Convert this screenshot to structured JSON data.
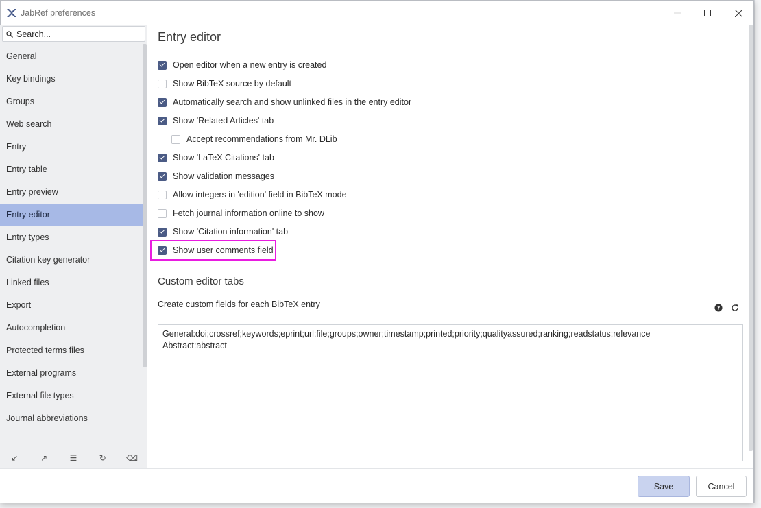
{
  "window": {
    "title": "JabRef preferences",
    "controls": {
      "minimize": "—",
      "maximize": "☐",
      "close": "✕"
    }
  },
  "sidebar": {
    "search_placeholder": "Search...",
    "items": [
      {
        "label": "General"
      },
      {
        "label": "Key bindings"
      },
      {
        "label": "Groups"
      },
      {
        "label": "Web search"
      },
      {
        "label": "Entry"
      },
      {
        "label": "Entry table"
      },
      {
        "label": "Entry preview"
      },
      {
        "label": "Entry editor",
        "selected": true
      },
      {
        "label": "Entry types"
      },
      {
        "label": "Citation key generator"
      },
      {
        "label": "Linked files"
      },
      {
        "label": "Export"
      },
      {
        "label": "Autocompletion"
      },
      {
        "label": "Protected terms files"
      },
      {
        "label": "External programs"
      },
      {
        "label": "External file types"
      },
      {
        "label": "Journal abbreviations"
      }
    ],
    "tools": [
      {
        "icon": "import-arrow-icon",
        "glyph": "↙"
      },
      {
        "icon": "export-arrow-icon",
        "glyph": "↗"
      },
      {
        "icon": "list-icon",
        "glyph": "☰"
      },
      {
        "icon": "refresh-icon",
        "glyph": "↻"
      },
      {
        "icon": "eraser-icon",
        "glyph": "⌫"
      }
    ]
  },
  "main": {
    "title": "Entry editor",
    "options": [
      {
        "label": "Open editor when a new entry is created",
        "checked": true,
        "indent": 0
      },
      {
        "label": "Show BibTeX source by default",
        "checked": false,
        "indent": 0
      },
      {
        "label": "Automatically search and show unlinked files in the entry editor",
        "checked": true,
        "indent": 0
      },
      {
        "label": "Show 'Related Articles' tab",
        "checked": true,
        "indent": 0
      },
      {
        "label": "Accept recommendations from Mr. DLib",
        "checked": false,
        "indent": 1
      },
      {
        "label": "Show 'LaTeX Citations' tab",
        "checked": true,
        "indent": 0
      },
      {
        "label": "Show validation messages",
        "checked": true,
        "indent": 0
      },
      {
        "label": "Allow integers in 'edition' field in BibTeX mode",
        "checked": false,
        "indent": 0
      },
      {
        "label": "Fetch journal information online to show",
        "checked": false,
        "indent": 0
      },
      {
        "label": "Show 'Citation information' tab",
        "checked": true,
        "indent": 0
      },
      {
        "label": "Show user comments field",
        "checked": true,
        "indent": 0,
        "highlighted": true
      }
    ],
    "custom_tabs": {
      "title": "Custom editor tabs",
      "description": "Create custom fields for each BibTeX entry",
      "lines": [
        "General:doi;crossref;keywords;eprint;url;file;groups;owner;timestamp;printed;priority;qualityassured;ranking;readstatus;relevance",
        "Abstract:abstract"
      ]
    }
  },
  "footer": {
    "save_label": "Save",
    "cancel_label": "Cancel"
  },
  "colors": {
    "accent_selected": "#a7b9e6",
    "checkbox_checked": "#4b5b85",
    "highlight": "#e81ce0",
    "save_bg": "#c9d3ef"
  }
}
